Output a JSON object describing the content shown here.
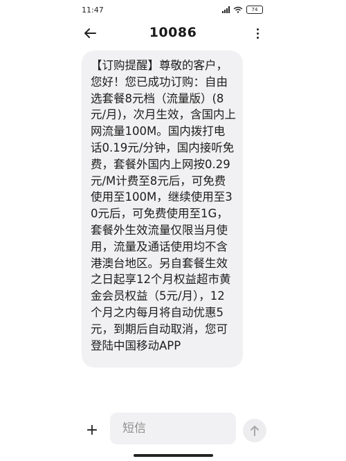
{
  "status_bar": {
    "time": "11:47",
    "battery": "74"
  },
  "header": {
    "title": "10086",
    "back_icon": "arrow-left-icon",
    "more_icon": "more-vertical-icon"
  },
  "message": {
    "text": "【订购提醒】尊敬的客户，您好！您已成功订购：自由选套餐8元档（流量版）(8元/月)，次月生效，含国内上网流量100M。国内拨打电话0.19元/分钟，国内接听免费，套餐外国内上网按0.29元/M计费至8元后，可免费使用至100M，继续使用至30元后，可免费使用至1G，套餐外生效流量仅限当月使用，流量及通话使用均不含港澳台地区。另自套餐生效之日起享12个月权益超市黄金会员权益（5元/月），12个月之内每月将自动优惠5元，到期后自动取消，您可登陆中国移动APP"
  },
  "input_bar": {
    "placeholder": "短信",
    "add_icon": "plus-icon",
    "send_icon": "arrow-up-icon"
  },
  "colors": {
    "bubble": "#f1f1f3",
    "text": "#1d1d1d",
    "background": "#ffffff"
  }
}
